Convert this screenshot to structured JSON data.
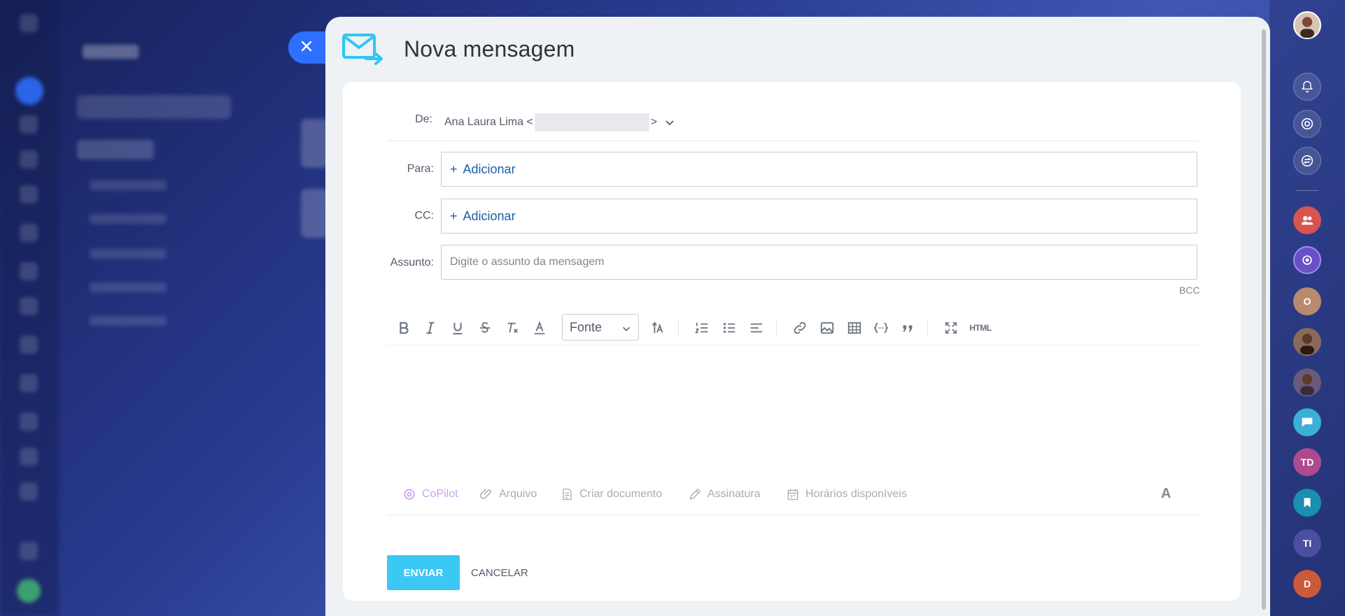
{
  "window": {
    "title": "Nova mensagem"
  },
  "close_button": {
    "icon": "close-icon"
  },
  "form": {
    "from_label": "De:",
    "from_name": "Ana Laura Lima <",
    "from_suffix": ">",
    "to_label": "Para:",
    "to_add": "Adicionar",
    "cc_label": "CC:",
    "cc_add": "Adicionar",
    "subject_label": "Assunto:",
    "subject_placeholder": "Digite o assunto da mensagem",
    "subject_value": "",
    "bcc": "BCC"
  },
  "toolbar": {
    "font_select": "Fonte",
    "html_label": "HTML",
    "items": [
      "bold-icon",
      "italic-icon",
      "underline-icon",
      "strikethrough-icon",
      "clear-format-icon",
      "text-color-icon",
      "font-size-icon",
      "numbered-list-icon",
      "bullet-list-icon",
      "align-left-icon",
      "link-icon",
      "image-icon",
      "table-icon",
      "code-icon",
      "quote-icon",
      "fullscreen-icon"
    ]
  },
  "actions": {
    "copilot": "CoPilot",
    "file": "Arquivo",
    "create_doc": "Criar documento",
    "signature": "Assinatura",
    "schedule": "Horários disponíveis",
    "format_toggle": "A"
  },
  "buttons": {
    "send": "ENVIAR",
    "cancel": "CANCELAR"
  },
  "right_rail": {
    "items": [
      {
        "type": "avatar"
      },
      {
        "type": "icon",
        "icon": "bell-icon"
      },
      {
        "type": "icon",
        "icon": "copilot-icon"
      },
      {
        "type": "icon",
        "icon": "sync-icon"
      },
      {
        "type": "icon",
        "icon": "group-icon",
        "color": "#d9534f"
      },
      {
        "type": "icon",
        "icon": "copilot-icon",
        "color": "#6a4fc7"
      },
      {
        "type": "initials",
        "text": "O",
        "color": "#b98a70"
      },
      {
        "type": "avatar"
      },
      {
        "type": "avatar"
      },
      {
        "type": "icon",
        "icon": "chat-icon",
        "color": "#3ab0d8"
      },
      {
        "type": "initials",
        "text": "TD",
        "color": "#b04a8e"
      },
      {
        "type": "icon",
        "icon": "bookmark-icon",
        "color": "#1a8fb0"
      },
      {
        "type": "initials",
        "text": "TI",
        "color": "#4a4fa0"
      },
      {
        "type": "initials",
        "text": "D",
        "color": "#cc5a3a"
      }
    ]
  },
  "colors": {
    "accent": "#3bc8f5",
    "link": "#1e5fa8",
    "close_bg": "#2f6fff",
    "modal_bg": "#eef2f4"
  }
}
